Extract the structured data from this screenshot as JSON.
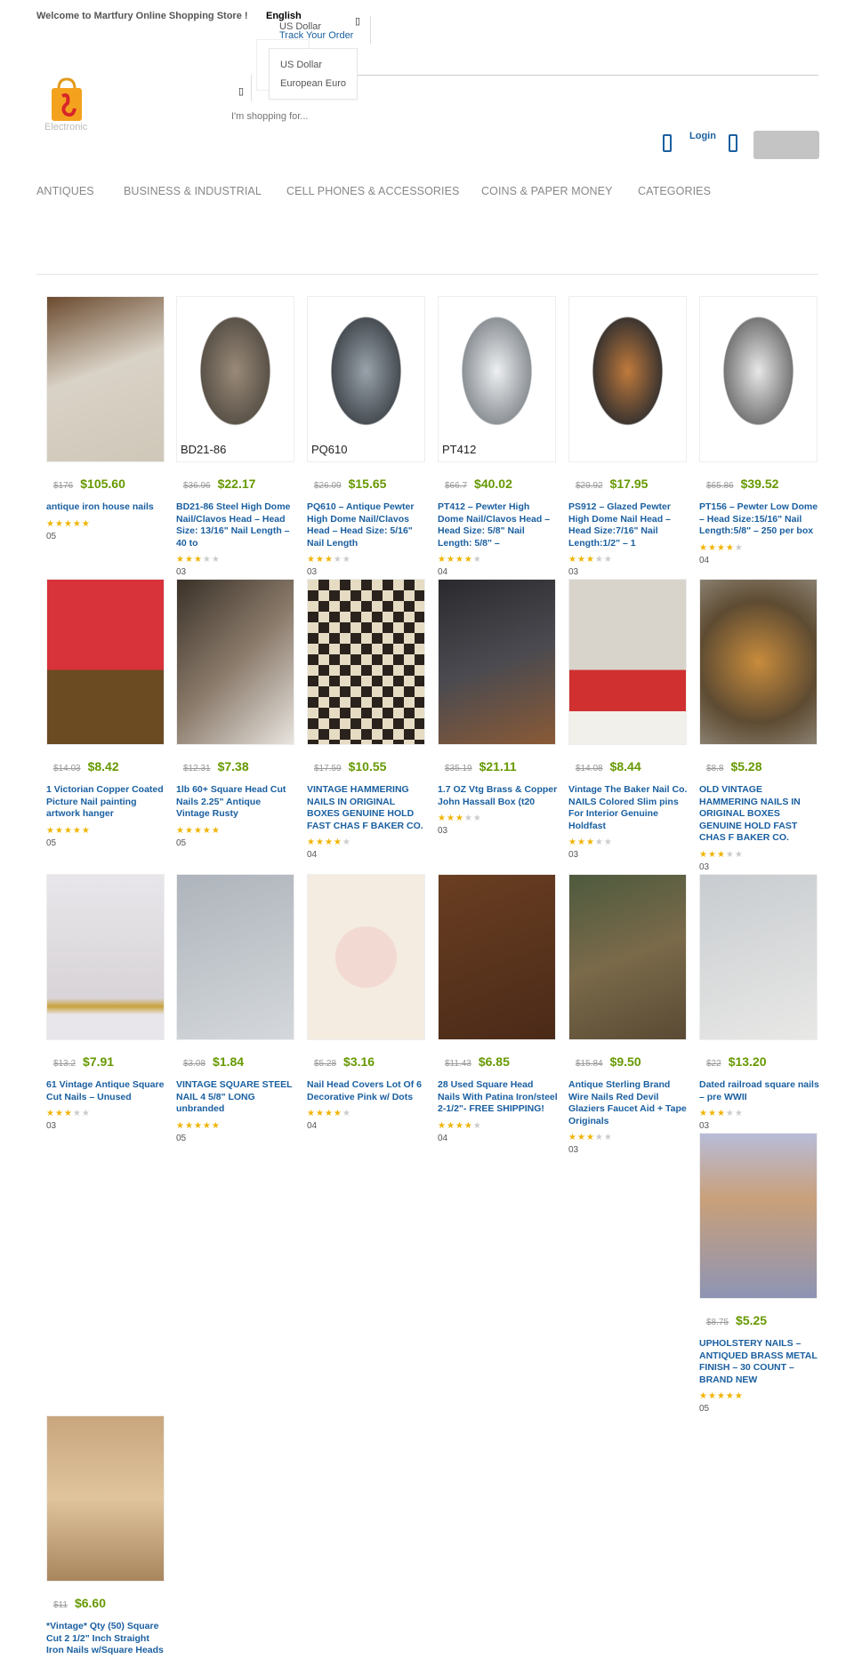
{
  "topbar": {
    "welcome": "Welcome to Martfury Online Shopping Store !",
    "language": "English",
    "currency": "US Dollar",
    "track_order": "Track Your Order"
  },
  "currency_dropdown": {
    "options": [
      "US Dollar",
      "European Euro"
    ]
  },
  "logo": {
    "text": "Electronic"
  },
  "search": {
    "placeholder": "I'm shopping for..."
  },
  "header": {
    "login": "Login"
  },
  "nav": {
    "items": [
      "Antiques",
      "Business & Industrial",
      "Cell Phones & Accessories",
      "Coins & Paper Money",
      "Categories"
    ]
  },
  "colors": {
    "accent": "#1a5fa0",
    "price": "#669900",
    "star": "#f0b400"
  },
  "products": [
    {
      "old": "$176",
      "price": "$105.60",
      "title": "antique iron house nails",
      "rating": 5,
      "rating_label": "05",
      "caption": ""
    },
    {
      "old": "$36.96",
      "price": "$22.17",
      "title": "BD21-86 Steel High Dome Nail/Clavos Head – Head Size: 13/16\" Nail Length – 40 to",
      "rating": 3,
      "rating_label": "03",
      "caption": "BD21-86"
    },
    {
      "old": "$26.09",
      "price": "$15.65",
      "title": "PQ610 – Antique Pewter High Dome Nail/Clavos Head – Head Size: 5/16\" Nail Length",
      "rating": 3,
      "rating_label": "03",
      "caption": "PQ610"
    },
    {
      "old": "$66.7",
      "price": "$40.02",
      "title": "PT412 – Pewter High Dome Nail/Clavos Head – Head Size: 5/8\" Nail Length: 5/8\" –",
      "rating": 4,
      "rating_label": "04",
      "caption": "PT412"
    },
    {
      "old": "$29.92",
      "price": "$17.95",
      "title": "PS912 – Glazed Pewter High Dome Nail Head – Head Size:7/16\" Nail Length:1/2\" – 1",
      "rating": 3,
      "rating_label": "03",
      "caption": ""
    },
    {
      "old": "$65.86",
      "price": "$39.52",
      "title": "PT156 – Pewter Low Dome – Head Size:15/16\" Nail Length:5/8\" – 250 per box",
      "rating": 4,
      "rating_label": "04",
      "caption": ""
    },
    {
      "old": "$14.03",
      "price": "$8.42",
      "title": "1 Victorian Copper Coated Picture Nail painting artwork hanger",
      "rating": 5,
      "rating_label": "05",
      "caption": ""
    },
    {
      "old": "$12.31",
      "price": "$7.38",
      "title": "1lb 60+ Square Head Cut Nails 2.25\" Antique Vintage Rusty",
      "rating": 5,
      "rating_label": "05",
      "caption": ""
    },
    {
      "old": "$17.59",
      "price": "$10.55",
      "title": "VINTAGE HAMMERING NAILS IN ORIGINAL BOXES GENUINE HOLD FAST CHAS F BAKER CO.",
      "rating": 4,
      "rating_label": "04",
      "caption": ""
    },
    {
      "old": "$35.19",
      "price": "$21.11",
      "title": "1.7 OZ Vtg Brass & Copper John Hassall Box (t20",
      "rating": 3,
      "rating_label": "03",
      "caption": ""
    },
    {
      "old": "$14.08",
      "price": "$8.44",
      "title": "Vintage The Baker Nail Co. NAILS Colored Slim pins For Interior Genuine Holdfast",
      "rating": 3,
      "rating_label": "03",
      "caption": ""
    },
    {
      "old": "$8.8",
      "price": "$5.28",
      "title": "OLD VINTAGE HAMMERING NAILS IN ORIGINAL BOXES GENUINE HOLD FAST CHAS F BAKER CO.",
      "rating": 3,
      "rating_label": "03",
      "caption": ""
    },
    {
      "old": "$13.2",
      "price": "$7.91",
      "title": "61 Vintage Antique Square Cut Nails – Unused",
      "rating": 3,
      "rating_label": "03",
      "caption": ""
    },
    {
      "old": "$3.08",
      "price": "$1.84",
      "title": "VINTAGE SQUARE STEEL NAIL 4 5/8\" LONG unbranded",
      "rating": 5,
      "rating_label": "05",
      "caption": ""
    },
    {
      "old": "$5.28",
      "price": "$3.16",
      "title": "Nail Head Covers Lot Of 6 Decorative Pink w/ Dots",
      "rating": 4,
      "rating_label": "04",
      "caption": ""
    },
    {
      "old": "$11.43",
      "price": "$6.85",
      "title": "28 Used Square Head Nails With Patina Iron/steel 2-1/2\"- FREE SHIPPING!",
      "rating": 4,
      "rating_label": "04",
      "caption": ""
    },
    {
      "old": "$15.84",
      "price": "$9.50",
      "title": "Antique Sterling Brand Wire Nails Red Devil Glaziers Faucet Aid + Tape Originals",
      "rating": 3,
      "rating_label": "03",
      "caption": ""
    },
    {
      "old": "$22",
      "price": "$13.20",
      "title": "Dated railroad square nails – pre WWII",
      "rating": 3,
      "rating_label": "03",
      "caption": ""
    },
    {
      "old": "$8.75",
      "price": "$5.25",
      "title": "UPHOLSTERY NAILS – ANTIQUED BRASS METAL FINISH – 30 COUNT – BRAND NEW",
      "rating": 5,
      "rating_label": "05",
      "caption": ""
    },
    {
      "old": "$11",
      "price": "$6.60",
      "title": "*Vintage* Qty (50) Square Cut 2 1/2\" Inch Straight Iron Nails w/Square Heads",
      "rating": null,
      "rating_label": null,
      "caption": ""
    }
  ]
}
